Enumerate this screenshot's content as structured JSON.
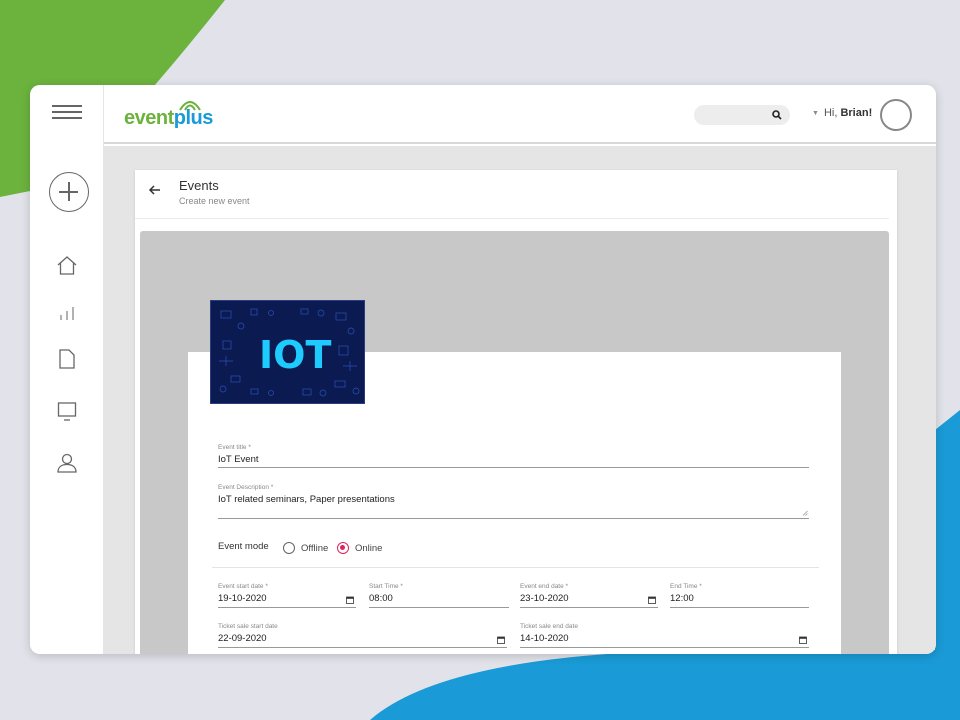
{
  "colors": {
    "brand_green": "#6cb33e",
    "brand_blue": "#1a9bd7",
    "accent_pink": "#e0245e",
    "image_bg": "#0c1a52",
    "image_glow": "#1ecbff"
  },
  "logo": {
    "part1": "event",
    "part2": "plus"
  },
  "search": {
    "placeholder": ""
  },
  "user": {
    "greeting": "Hi,",
    "name": "Brian!"
  },
  "sidebar": {
    "items": [
      "home-icon",
      "bar-chart-icon",
      "document-icon",
      "monitor-icon",
      "user-icon"
    ]
  },
  "header": {
    "title": "Events",
    "subtitle": "Create new event"
  },
  "image": {
    "text": "IOT"
  },
  "form": {
    "title": {
      "label": "Event title *",
      "value": "IoT Event"
    },
    "description": {
      "label": "Event Description *",
      "value": "IoT related seminars, Paper presentations"
    },
    "mode": {
      "label": "Event mode",
      "options": [
        "Offline",
        "Online"
      ],
      "selected": "Online"
    },
    "start_date": {
      "label": "Event start date *",
      "value": "19-10-2020"
    },
    "start_time": {
      "label": "Start Time *",
      "value": "08:00"
    },
    "end_date": {
      "label": "Event end date *",
      "value": "23-10-2020"
    },
    "end_time": {
      "label": "End Time *",
      "value": "12:00"
    },
    "ticket_start": {
      "label": "Ticket sale start date",
      "value": "22-09-2020"
    },
    "ticket_end": {
      "label": "Ticket sale end date",
      "value": "14-10-2020"
    }
  }
}
